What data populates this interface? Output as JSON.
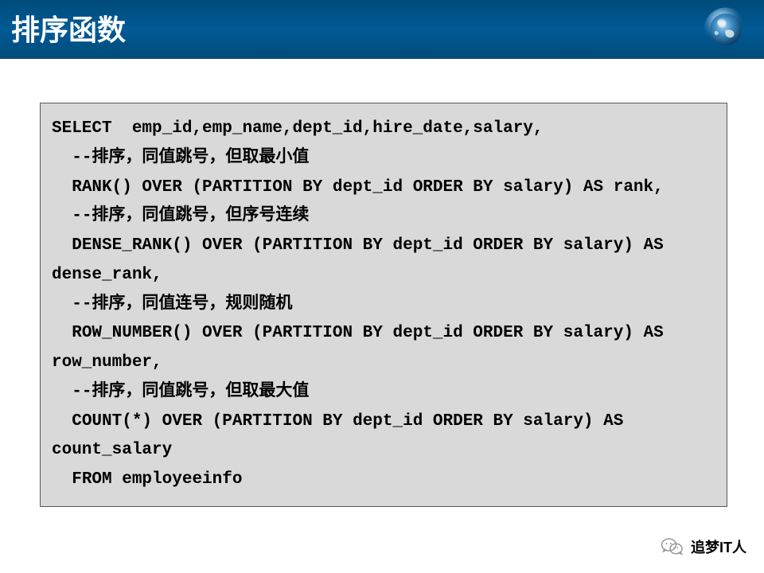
{
  "header": {
    "title": "排序函数",
    "icon": "globe-icon"
  },
  "code": {
    "line1": "SELECT  emp_id,emp_name,dept_id,hire_date,salary,",
    "line2": "  --排序，同值跳号，但取最小值",
    "line3": "  RANK() OVER (PARTITION BY dept_id ORDER BY salary) AS rank,",
    "line4": "  --排序，同值跳号，但序号连续",
    "line5": "  DENSE_RANK() OVER (PARTITION BY dept_id ORDER BY salary) AS dense_rank,",
    "line6": "  --排序，同值连号，规则随机",
    "line7": "  ROW_NUMBER() OVER (PARTITION BY dept_id ORDER BY salary) AS row_number,",
    "line8": "  --排序，同值跳号，但取最大值",
    "line9": "  COUNT(*) OVER (PARTITION BY dept_id ORDER BY salary) AS count_salary",
    "line10": "  FROM employeeinfo"
  },
  "watermark": {
    "text": "追梦IT人",
    "icon": "wechat-icon"
  }
}
